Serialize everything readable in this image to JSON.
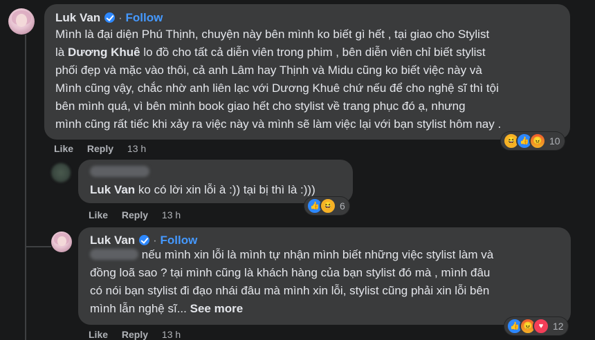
{
  "comment1": {
    "author": "Luk Van",
    "follow": "Follow",
    "dot": "·",
    "lines": [
      "Mình là đại diện Phú Thịnh, chuyện này bên mình ko biết gì hết , tại giao cho Stylist",
      "lo đồ cho tất cả diễn viên trong phim , bên diễn viên chỉ biết stylist",
      "phối đẹp và mặc vào thôi, cả anh Lâm hay Thịnh và Midu cũng ko biết việc này và",
      "Mình cũng vậy, chắc nhờ anh liên lạc với Dương Khuê chứ nếu để cho nghệ sĩ thì tội",
      "bên mình quá, vì bên mình book giao hết cho stylist về trang phục đó ạ, nhưng",
      "mình cũng rất tiếc khi xảy ra việc này và mình sẽ làm việc lại với bạn stylist hôm nay ."
    ],
    "line2_prefix": "là",
    "bold_name": "Dương Khuê",
    "like": "Like",
    "reply": "Reply",
    "time": "13 h",
    "reaction_count": "10",
    "reaction_icons": [
      "haha-icon",
      "like-icon",
      "angry-icon"
    ]
  },
  "comment2": {
    "mention": "Luk Van",
    "text": "ko có lời xin lỗi à :)) tại bị thì là :)))",
    "like": "Like",
    "reply": "Reply",
    "time": "13 h",
    "reaction_count": "6",
    "reaction_icons": [
      "like-icon",
      "haha-icon"
    ]
  },
  "comment3": {
    "author": "Luk Van",
    "follow": "Follow",
    "dot": "·",
    "lines": [
      "nếu mình xin lỗi là mình tự nhận mình biết những việc stylist làm và",
      "đồng loã sao ? tại mình cũng là khách hàng của bạn stylist đó mà , mình đâu",
      "có nói bạn stylist đi đạo nhái đâu mà mình xin lỗi, stylist cũng phải xin lỗi bên",
      "mình lẫn nghệ sĩ..."
    ],
    "see_more": "See more",
    "like": "Like",
    "reply": "Reply",
    "time": "13 h",
    "reaction_count": "12",
    "reaction_icons": [
      "like-icon",
      "angry-icon",
      "love-icon"
    ]
  }
}
